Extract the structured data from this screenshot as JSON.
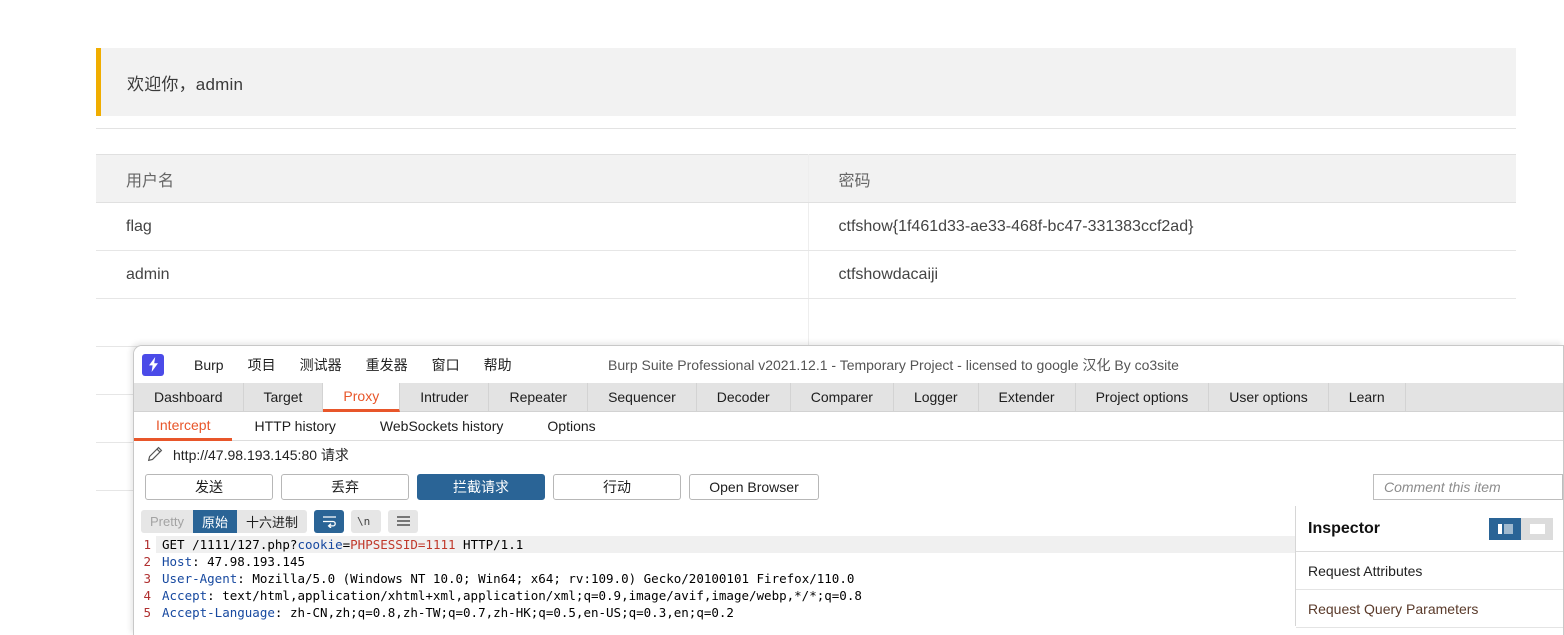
{
  "webpage": {
    "welcome": "欢迎你，admin",
    "table": {
      "headers": [
        "用户名",
        "密码"
      ],
      "rows": [
        {
          "username": "flag",
          "password": "ctfshow{1f461d33-ae33-468f-bc47-331383ccf2ad}"
        },
        {
          "username": "admin",
          "password": "ctfshowdacaiji"
        }
      ]
    },
    "accent_color": "#f0ad00"
  },
  "burp": {
    "logo_icon": "lightning-bolt-icon",
    "title": "Burp Suite Professional v2021.12.1 - Temporary Project - licensed to google 汉化 By co3site",
    "menu": [
      "Burp",
      "项目",
      "测试器",
      "重发器",
      "窗口",
      "帮助"
    ],
    "tabs": [
      "Dashboard",
      "Target",
      "Proxy",
      "Intruder",
      "Repeater",
      "Sequencer",
      "Decoder",
      "Comparer",
      "Logger",
      "Extender",
      "Project options",
      "User options",
      "Learn"
    ],
    "active_tab": "Proxy",
    "subtabs": [
      "Intercept",
      "HTTP history",
      "WebSockets history",
      "Options"
    ],
    "active_subtab": "Intercept",
    "request_label": {
      "icon": "pencil-icon",
      "text": "http://47.98.193.145:80 请求"
    },
    "buttons": {
      "forward": "发送",
      "drop": "丢弃",
      "intercept": "拦截请求",
      "action": "行动",
      "open_browser": "Open Browser"
    },
    "comment_placeholder": "Comment this item",
    "formats": {
      "pretty": "Pretty",
      "raw": "原始",
      "hex": "十六进制",
      "selected": "原始",
      "wrap_icon": "word-wrap-icon",
      "newline_icon": "newline-escape-icon",
      "menu_icon": "hamburger-menu-icon"
    },
    "request": {
      "lines": [
        {
          "n": "1",
          "segments": [
            {
              "t": "GET /1111/127.php?",
              "c": "plain"
            },
            {
              "t": "cookie",
              "c": "blue"
            },
            {
              "t": "=",
              "c": "plain"
            },
            {
              "t": "PHPSESSID=1111",
              "c": "red"
            },
            {
              "t": " HTTP/1.1",
              "c": "plain"
            }
          ]
        },
        {
          "n": "2",
          "segments": [
            {
              "t": "Host",
              "c": "blue"
            },
            {
              "t": ": 47.98.193.145",
              "c": "plain"
            }
          ]
        },
        {
          "n": "3",
          "segments": [
            {
              "t": "User-Agent",
              "c": "blue"
            },
            {
              "t": ": Mozilla/5.0 (Windows NT 10.0; Win64; x64; rv:109.0) Gecko/20100101 Firefox/110.0",
              "c": "plain"
            }
          ]
        },
        {
          "n": "4",
          "segments": [
            {
              "t": "Accept",
              "c": "blue"
            },
            {
              "t": ": text/html,application/xhtml+xml,application/xml;q=0.9,image/avif,image/webp,*/*;q=0.8",
              "c": "plain"
            }
          ]
        },
        {
          "n": "5",
          "segments": [
            {
              "t": "Accept-Language",
              "c": "blue"
            },
            {
              "t": ": zh-CN,zh;q=0.8,zh-TW;q=0.7,zh-HK;q=0.5,en-US;q=0.3,en;q=0.2",
              "c": "plain"
            }
          ]
        }
      ]
    },
    "inspector": {
      "title": "Inspector",
      "layout_buttons": [
        "layout-split-icon",
        "layout-full-icon"
      ],
      "sections": [
        "Request Attributes",
        "Request Query Parameters"
      ]
    }
  }
}
